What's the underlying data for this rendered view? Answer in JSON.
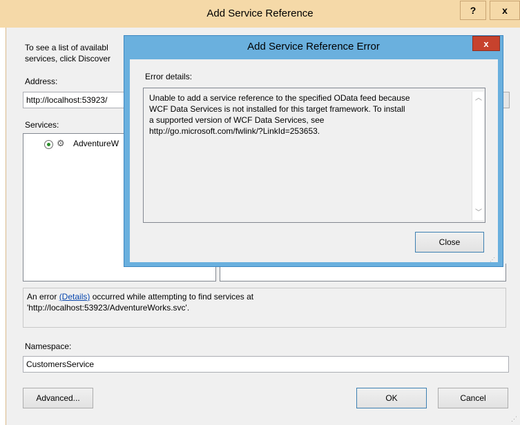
{
  "window": {
    "title": "Add Service Reference",
    "help_label": "?",
    "close_label": "x"
  },
  "intro": {
    "line1": "To see a list of availabl",
    "line2": "services, click Discover"
  },
  "address": {
    "label": "Address:",
    "value": "http://localhost:53923/"
  },
  "services": {
    "label": "Services:",
    "items": [
      {
        "label": "AdventureW",
        "selected": true
      }
    ]
  },
  "error_bar": {
    "prefix": "An error ",
    "link": "(Details)",
    "suffix": " occurred while attempting to find services at",
    "line2": "'http://localhost:53923/AdventureWorks.svc'."
  },
  "namespace": {
    "label": "Namespace:",
    "value": "CustomersService"
  },
  "buttons": {
    "advanced": "Advanced...",
    "ok": "OK",
    "cancel": "Cancel"
  },
  "error_dialog": {
    "title": "Add Service Reference Error",
    "close_label": "x",
    "details_label": "Error details:",
    "message_lines": [
      "Unable to add a service reference to the specified OData feed because",
      "WCF Data Services is not installed for this target framework. To install",
      "a supported version of WCF Data Services, see",
      "http://go.microsoft.com/fwlink/?LinkId=253653."
    ],
    "close_button": "Close"
  },
  "colors": {
    "outer_frame": "#f5d9a8",
    "dialog_frame": "#6ab0de",
    "close_red": "#c7422d",
    "link_blue": "#0645ad"
  }
}
